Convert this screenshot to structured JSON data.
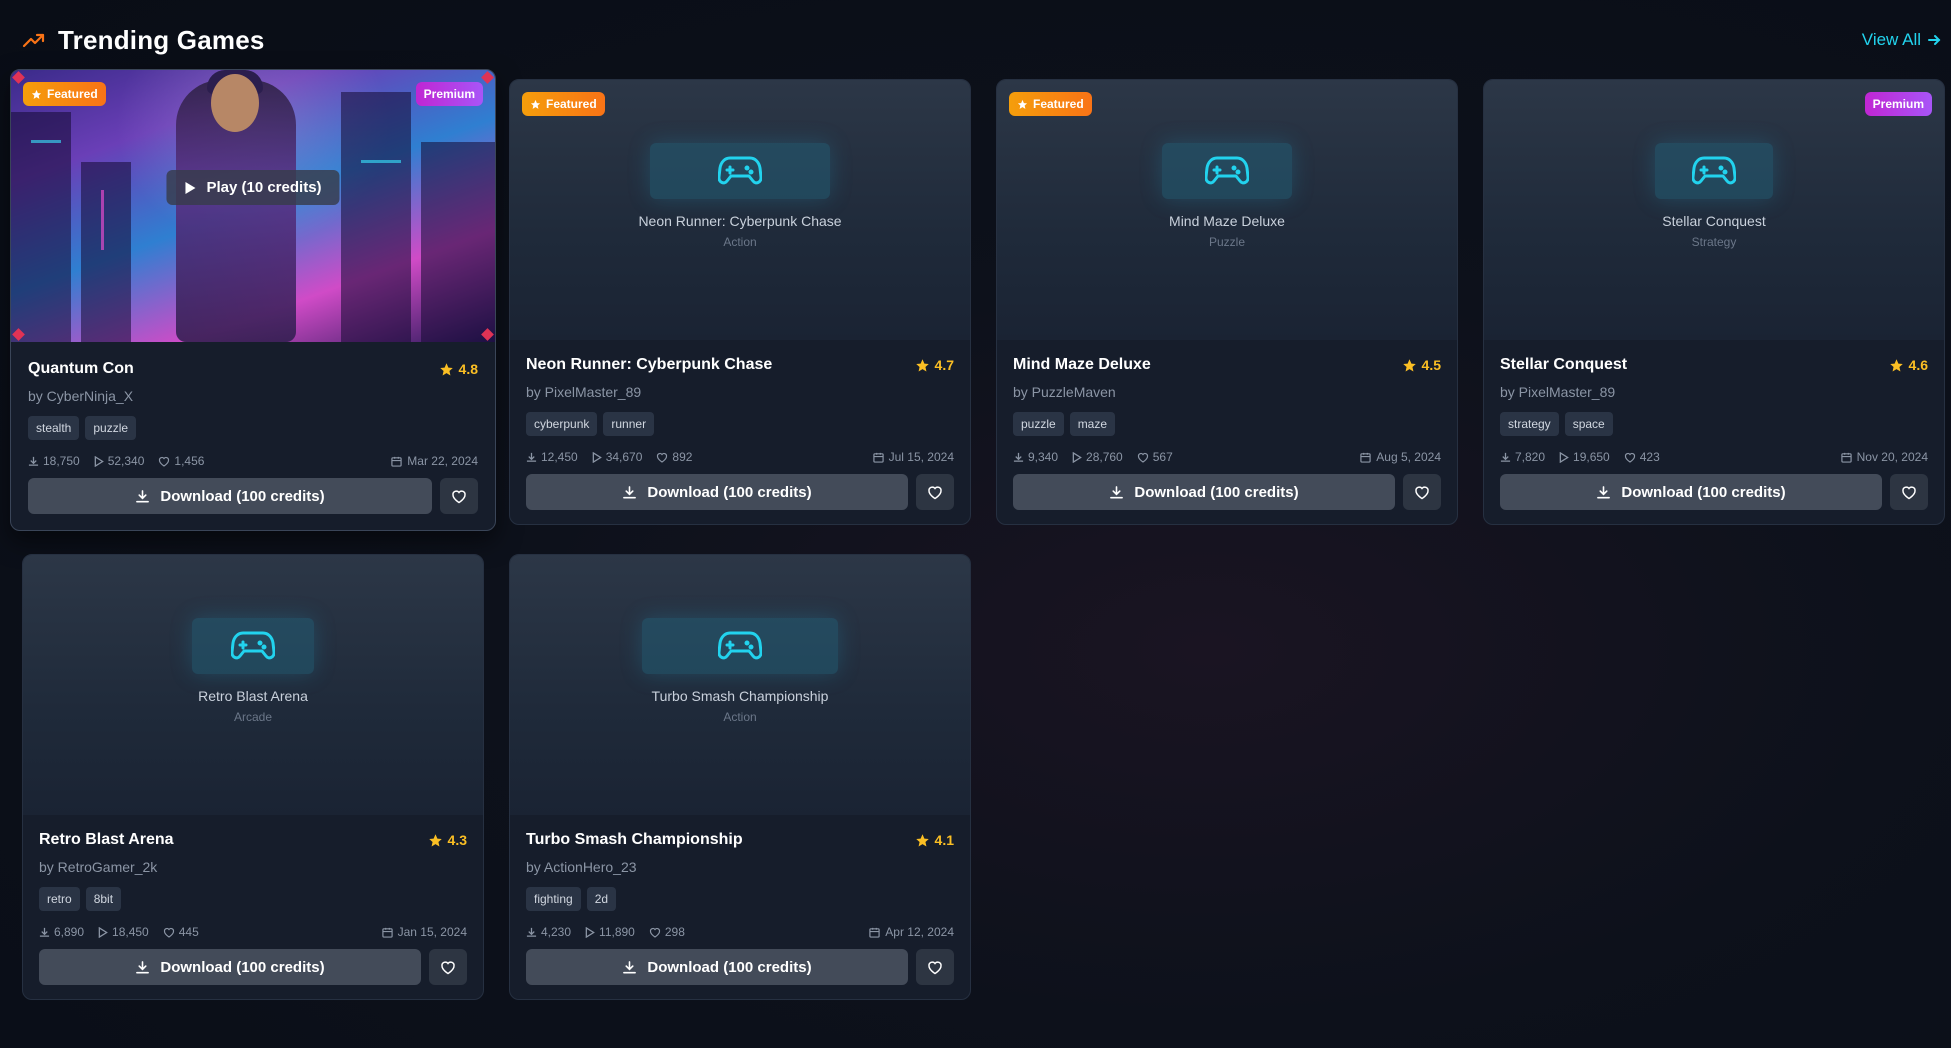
{
  "header": {
    "title": "Trending Games",
    "view_all": "View All"
  },
  "cards": [
    {
      "title": "Quantum Con",
      "author": "by CyberNinja_X",
      "rating": "4.8",
      "featured": "Featured",
      "premium": "Premium",
      "play_label": "Play (10 credits)",
      "tags": [
        "stealth",
        "puzzle"
      ],
      "downloads": "18,750",
      "plays": "52,340",
      "likes": "1,456",
      "date": "Mar 22, 2024",
      "download_label": "Download (100 credits)"
    },
    {
      "title": "Neon Runner: Cyberpunk Chase",
      "author": "by PixelMaster_89",
      "rating": "4.7",
      "featured": "Featured",
      "genre": "Action",
      "tags": [
        "cyberpunk",
        "runner"
      ],
      "downloads": "12,450",
      "plays": "34,670",
      "likes": "892",
      "date": "Jul 15, 2024",
      "download_label": "Download (100 credits)"
    },
    {
      "title": "Mind Maze Deluxe",
      "author": "by PuzzleMaven",
      "rating": "4.5",
      "featured": "Featured",
      "genre": "Puzzle",
      "tags": [
        "puzzle",
        "maze"
      ],
      "downloads": "9,340",
      "plays": "28,760",
      "likes": "567",
      "date": "Aug 5, 2024",
      "download_label": "Download (100 credits)"
    },
    {
      "title": "Stellar Conquest",
      "author": "by PixelMaster_89",
      "rating": "4.6",
      "premium": "Premium",
      "genre": "Strategy",
      "tags": [
        "strategy",
        "space"
      ],
      "downloads": "7,820",
      "plays": "19,650",
      "likes": "423",
      "date": "Nov 20, 2024",
      "download_label": "Download (100 credits)"
    },
    {
      "title": "Retro Blast Arena",
      "author": "by RetroGamer_2k",
      "rating": "4.3",
      "genre": "Arcade",
      "tags": [
        "retro",
        "8bit"
      ],
      "downloads": "6,890",
      "plays": "18,450",
      "likes": "445",
      "date": "Jan 15, 2024",
      "download_label": "Download (100 credits)"
    },
    {
      "title": "Turbo Smash Championship",
      "author": "by ActionHero_23",
      "rating": "4.1",
      "genre": "Action",
      "tags": [
        "fighting",
        "2d"
      ],
      "downloads": "4,230",
      "plays": "11,890",
      "likes": "298",
      "date": "Apr 12, 2024",
      "download_label": "Download (100 credits)"
    }
  ],
  "colors": {
    "accent": "#22d3ee",
    "rating": "#fbbf24",
    "featured": "#f59e0b",
    "premium": "#c026d3"
  },
  "icons": [
    "trending-up-icon",
    "arrow-right-icon",
    "star-icon",
    "gamepad-icon",
    "download-icon",
    "play-icon",
    "heart-icon",
    "calendar-icon"
  ]
}
